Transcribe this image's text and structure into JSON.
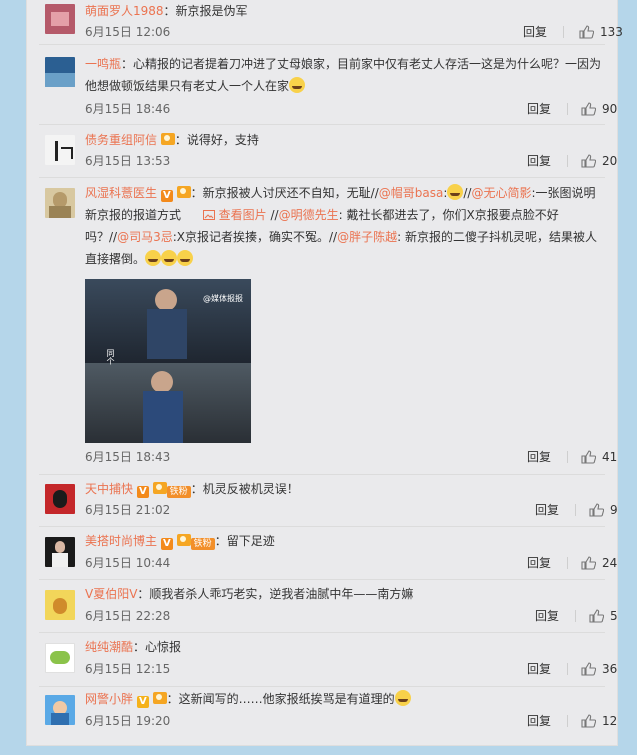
{
  "comments": [
    {
      "name": "萌面罗人1988",
      "text": "：新京报是伪军",
      "time": "6月15日 12:06",
      "reply": "回复",
      "likes": "133"
    },
    {
      "name": "一鸣瓶",
      "text": "：心精报的记者提着刀冲进了丈母娘家，目前家中仅有老丈人存活一这是为什么呢？一因为他想做顿饭结果只有老丈人一个人在家",
      "time": "6月15日 18:46",
      "reply": "回复",
      "likes": "90"
    },
    {
      "name": "债务重组阿信",
      "text": "：说得好，支持",
      "time": "6月15日 13:53",
      "reply": "回复",
      "likes": "20"
    },
    {
      "name": "风湿科薏医生",
      "text_a": "：新京报被人讨厌还不自知，无耻//",
      "mention1": "@帽哥basa",
      "text_b": ":",
      "text_c": "//",
      "mention2": "@无心简影",
      "text_d": ":一张图说明新京报的报道方式",
      "view_image": "查看图片",
      "text_e": "//",
      "mention3": "@明德先生",
      "text_f": ": 戴社长都进去了，你们X京报要点脸不好吗？//",
      "mention4": "@司马3忌",
      "text_g": ":X京报记者挨揍，确实不冤。//",
      "mention5": "@胖子陈越",
      "text_h": ": 新京报的二傻子抖机灵呢，结果被人直接撂倒。",
      "photo_caption1": "@媒体报报",
      "photo_caption2": "同个",
      "time": "6月15日 18:43",
      "reply": "回复",
      "likes": "41"
    },
    {
      "name": "天中捕快",
      "fan": "铁粉",
      "text": "：机灵反被机灵误！",
      "time": "6月15日 21:02",
      "reply": "回复",
      "likes": "9"
    },
    {
      "name": "美搭时尚博主",
      "fan": "铁粉",
      "text": "：留下足迹",
      "time": "6月15日 10:44",
      "reply": "回复",
      "likes": "24"
    },
    {
      "name": "V夏伯阳V",
      "text": "：顺我者杀人乖巧老实，逆我者油腻中年——南方嫲",
      "time": "6月15日 22:28",
      "reply": "回复",
      "likes": "5"
    },
    {
      "name": "纯纯潮酷",
      "text": "：心惊报",
      "time": "6月15日 12:15",
      "reply": "回复",
      "likes": "36"
    },
    {
      "name": "网警小胖",
      "text": "：这新闻写的……他家报纸挨骂是有道理的",
      "time": "6月15日 19:20",
      "reply": "回复",
      "likes": "12"
    }
  ],
  "colors": {
    "name": "#eb7350",
    "background": "#b5d6ea",
    "panel": "#eaeaec"
  }
}
